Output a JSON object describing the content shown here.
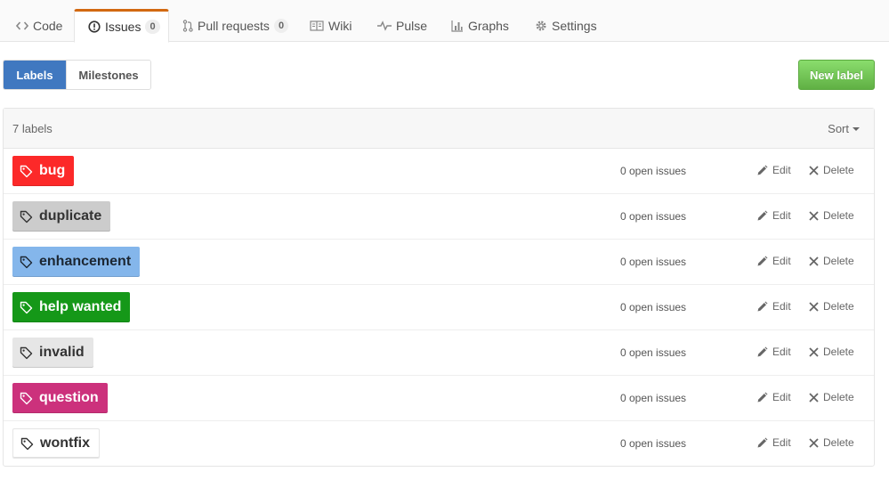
{
  "tabs": [
    {
      "label": "Code",
      "icon": "code-icon"
    },
    {
      "label": "Issues",
      "icon": "issue-opened-icon",
      "count": "0",
      "selected": true
    },
    {
      "label": "Pull requests",
      "icon": "git-pull-request-icon",
      "count": "0"
    },
    {
      "label": "Wiki",
      "icon": "book-icon"
    },
    {
      "label": "Pulse",
      "icon": "pulse-icon"
    },
    {
      "label": "Graphs",
      "icon": "graph-icon"
    },
    {
      "label": "Settings",
      "icon": "gear-icon"
    }
  ],
  "subnav": {
    "labels": "Labels",
    "milestones": "Milestones"
  },
  "new_label_button": "New label",
  "table": {
    "count_text": "7 labels",
    "sort_label": "Sort",
    "edit_label": "Edit",
    "delete_label": "Delete",
    "labels": [
      {
        "name": "bug",
        "color": "#fc2929",
        "text_color": "#ffffff",
        "open_issues": "0 open issues"
      },
      {
        "name": "duplicate",
        "color": "#cccccc",
        "text_color": "#333333",
        "open_issues": "0 open issues"
      },
      {
        "name": "enhancement",
        "color": "#84b6eb",
        "text_color": "#1c2733",
        "open_issues": "0 open issues"
      },
      {
        "name": "help wanted",
        "color": "#159818",
        "text_color": "#ffffff",
        "open_issues": "0 open issues"
      },
      {
        "name": "invalid",
        "color": "#e6e6e6",
        "text_color": "#333333",
        "open_issues": "0 open issues"
      },
      {
        "name": "question",
        "color": "#cc317c",
        "text_color": "#ffffff",
        "open_issues": "0 open issues"
      },
      {
        "name": "wontfix",
        "color": "#ffffff",
        "text_color": "#333333",
        "open_issues": "0 open issues"
      }
    ]
  },
  "colors": {
    "selected_tab_accent": "#d26911",
    "subnav_selected": "#4078c0",
    "new_label_green": "#6cc644"
  }
}
